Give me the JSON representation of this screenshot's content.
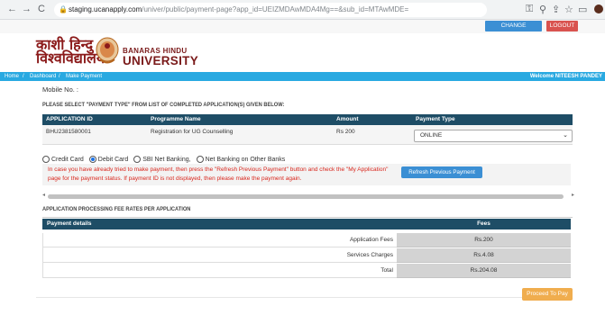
{
  "browser": {
    "back": "←",
    "reload": "C",
    "url_host": "staging.ucanapply.com",
    "url_path": "/univer/public/payment-page?app_id=UEIZMDAwMDA4Mg==&sub_id=MTAwMDE="
  },
  "top": {
    "change_password": "CHANGE PASSWORD",
    "logout": "LOGOUT"
  },
  "header": {
    "hindi_line1": "काशी हिन्दु",
    "hindi_line2": "विश्वविद्यालय",
    "en_line1": "BANARAS HINDU",
    "en_line2": "UNIVERSITY"
  },
  "nav": {
    "breadcrumb": [
      "Home",
      "Dashboard",
      "Make Payment"
    ],
    "welcome": "Welcome NITEESH PANDEY"
  },
  "mobile_label": "Mobile No. :",
  "instruction": "PLEASE SELECT \"PAYMENT TYPE\" FROM LIST OF COMPLETED APPLICATION(S) GIVEN BELOW:",
  "app_table": {
    "headers": [
      "APPLICATION ID",
      "Programme Name",
      "Amount",
      "Payment Type"
    ],
    "row": {
      "id": "BHU2381580001",
      "programme": "Registration for UG Counselling",
      "amount": "Rs 200",
      "payment_type": "ONLINE"
    }
  },
  "payment_options": {
    "options": [
      "Credit Card",
      "Debit Card",
      "SBI Net Banking,",
      "Net Banking on Other Banks"
    ],
    "selected": "Debit Card"
  },
  "warning": {
    "line1": "In case you have already tried to make payment, then press the \"Refresh Previous Payment\" button and check the \"My Application\"",
    "line2": "page for the payment status. If payment ID is not displayed, then please make the payment again."
  },
  "refresh_button": "Refresh Previous Payment",
  "fee_section_title": "APPLICATION PROCESSING FEE RATES PER APPLICATION",
  "fee_table": {
    "headers": [
      "Payment details",
      "Fees"
    ],
    "rows": [
      {
        "label": "Application Fees",
        "value": "Rs.200"
      },
      {
        "label": "Services Charges",
        "value": "Rs.4.08"
      },
      {
        "label": "Total",
        "value": "Rs.204.08"
      }
    ]
  },
  "proceed_button": "Proceed To Pay",
  "colors": {
    "nav_blue": "#29a9e1",
    "table_header": "#1e4d66",
    "warning_red": "#d9261c",
    "logout_red": "#d9534f",
    "proceed_orange": "#f0ad4e"
  }
}
